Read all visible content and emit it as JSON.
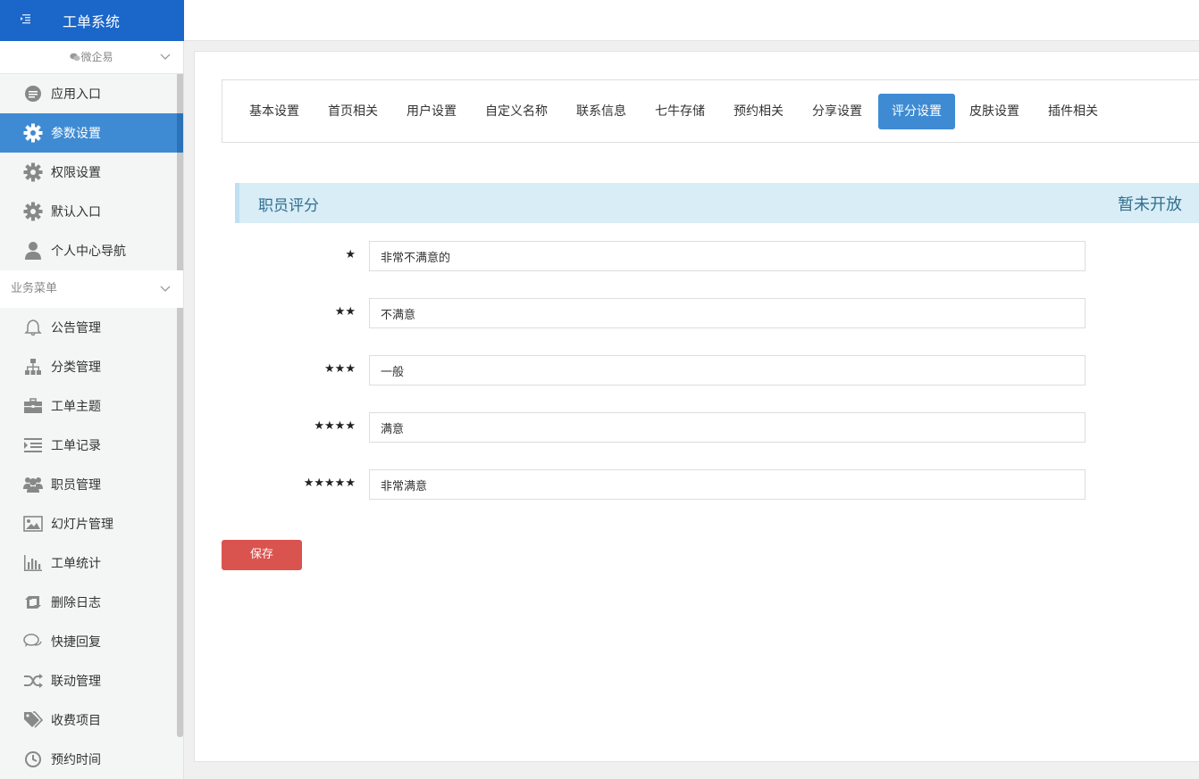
{
  "app": {
    "title": "工单系统"
  },
  "sidebar": {
    "account": "微企易",
    "section_header": "业务菜单",
    "top_items": [
      {
        "label": "应用入口",
        "icon": "chat-bubble-icon"
      },
      {
        "label": "参数设置",
        "icon": "gear-icon",
        "active": true
      },
      {
        "label": "权限设置",
        "icon": "gear-icon"
      },
      {
        "label": "默认入口",
        "icon": "gear-icon"
      },
      {
        "label": "个人中心导航",
        "icon": "user-icon"
      }
    ],
    "business_items": [
      {
        "label": "公告管理",
        "icon": "bell-icon"
      },
      {
        "label": "分类管理",
        "icon": "sitemap-icon"
      },
      {
        "label": "工单主题",
        "icon": "briefcase-icon"
      },
      {
        "label": "工单记录",
        "icon": "indent-list-icon"
      },
      {
        "label": "职员管理",
        "icon": "users-icon"
      },
      {
        "label": "幻灯片管理",
        "icon": "image-icon"
      },
      {
        "label": "工单统计",
        "icon": "bar-chart-icon"
      },
      {
        "label": "删除日志",
        "icon": "retweet-icon"
      },
      {
        "label": "快捷回复",
        "icon": "comments-icon"
      },
      {
        "label": "联动管理",
        "icon": "shuffle-icon"
      },
      {
        "label": "收费项目",
        "icon": "tags-icon"
      },
      {
        "label": "预约时间",
        "icon": "clock-icon"
      }
    ]
  },
  "tabs": [
    {
      "label": "基本设置"
    },
    {
      "label": "首页相关"
    },
    {
      "label": "用户设置"
    },
    {
      "label": "自定义名称"
    },
    {
      "label": "联系信息"
    },
    {
      "label": "七牛存储"
    },
    {
      "label": "预约相关"
    },
    {
      "label": "分享设置"
    },
    {
      "label": "评分设置",
      "active": true
    },
    {
      "label": "皮肤设置"
    },
    {
      "label": "插件相关"
    }
  ],
  "section": {
    "title": "职员评分",
    "status": "暂未开放"
  },
  "ratings": [
    {
      "stars": "★",
      "value": "非常不满意的"
    },
    {
      "stars": "★★",
      "value": "不满意"
    },
    {
      "stars": "★★★",
      "value": "一般"
    },
    {
      "stars": "★★★★",
      "value": "满意"
    },
    {
      "stars": "★★★★★",
      "value": "非常满意"
    }
  ],
  "save_label": "保存",
  "colors": {
    "brand": "#1a66c9",
    "active": "#3e8bd3",
    "danger": "#d9534f",
    "info_bg": "#d9edf7"
  }
}
